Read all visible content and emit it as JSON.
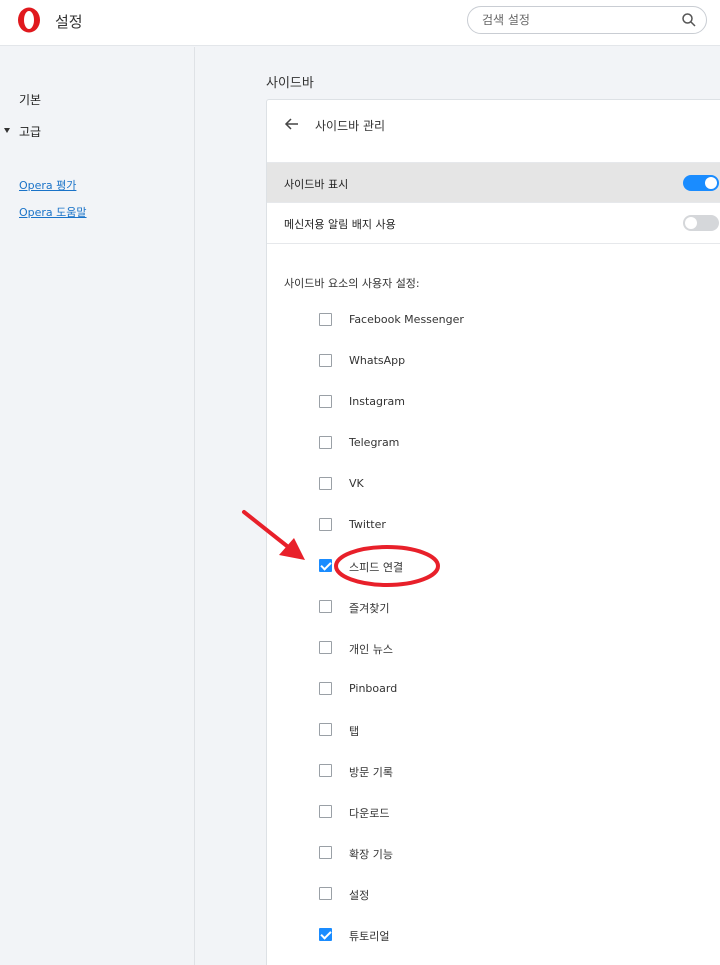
{
  "header": {
    "title": "설정",
    "search_placeholder": "검색 설정"
  },
  "sidebar": {
    "basic": "기본",
    "advanced": "고급",
    "links": [
      "Opera 평가",
      "Opera 도움말"
    ]
  },
  "main": {
    "section_title": "사이드바",
    "card_title": "사이드바 관리",
    "show_sidebar_label": "사이드바 표시",
    "show_sidebar_on": true,
    "badge_label": "메신저용 알림 배지 사용",
    "badge_on": false,
    "custom_label": "사이드바 요소의 사용자 설정:",
    "items": [
      {
        "label": "Facebook Messenger",
        "checked": false
      },
      {
        "label": "WhatsApp",
        "checked": false
      },
      {
        "label": "Instagram",
        "checked": false
      },
      {
        "label": "Telegram",
        "checked": false
      },
      {
        "label": "VK",
        "checked": false
      },
      {
        "label": "Twitter",
        "checked": false
      },
      {
        "label": "스피드 연결",
        "checked": true
      },
      {
        "label": "즐겨찾기",
        "checked": false
      },
      {
        "label": "개인 뉴스",
        "checked": false
      },
      {
        "label": "Pinboard",
        "checked": false
      },
      {
        "label": "탭",
        "checked": false
      },
      {
        "label": "방문 기록",
        "checked": false
      },
      {
        "label": "다운로드",
        "checked": false
      },
      {
        "label": "확장 기능",
        "checked": false
      },
      {
        "label": "설정",
        "checked": false
      },
      {
        "label": "튜토리얼",
        "checked": true
      }
    ]
  },
  "colors": {
    "accent": "#1a8cff",
    "annotation": "#e8202a",
    "brand": "#e0191e"
  }
}
